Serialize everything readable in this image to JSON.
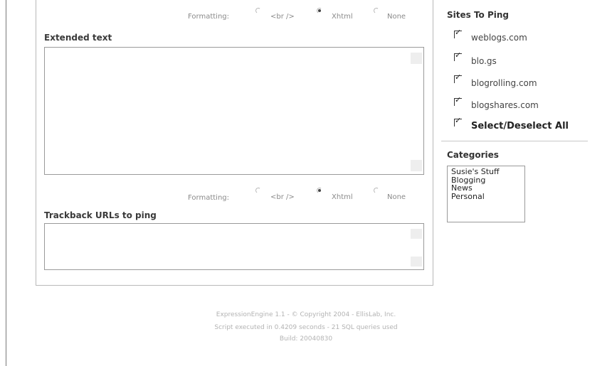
{
  "formatting_top": {
    "label": "Formatting:",
    "options": [
      "<br />",
      "Xhtml",
      "None"
    ],
    "selected": "Xhtml"
  },
  "extended_text": {
    "label": "Extended text",
    "value": ""
  },
  "formatting_bottom": {
    "label": "Formatting:",
    "options": [
      "<br />",
      "Xhtml",
      "None"
    ],
    "selected": "Xhtml"
  },
  "trackback": {
    "label": "Trackback URLs to ping",
    "value": ""
  },
  "sites_to_ping": {
    "title": "Sites To Ping",
    "sites": [
      {
        "label": "weblogs.com",
        "checked": true
      },
      {
        "label": "blo.gs",
        "checked": true
      },
      {
        "label": "blogrolling.com",
        "checked": true
      },
      {
        "label": "blogshares.com",
        "checked": true
      }
    ],
    "select_all": {
      "label": "Select/Deselect All",
      "checked": true
    }
  },
  "categories": {
    "title": "Categories",
    "items": [
      "Susie's Stuff",
      "Blogging",
      "News",
      "Personal"
    ]
  },
  "footer": {
    "line1": "ExpressionEngine 1.1 - © Copyright 2004 - EllisLab, Inc.",
    "line2": "Script executed in 0.4209 seconds - 21 SQL queries used",
    "line3": "Build: 20040830"
  }
}
